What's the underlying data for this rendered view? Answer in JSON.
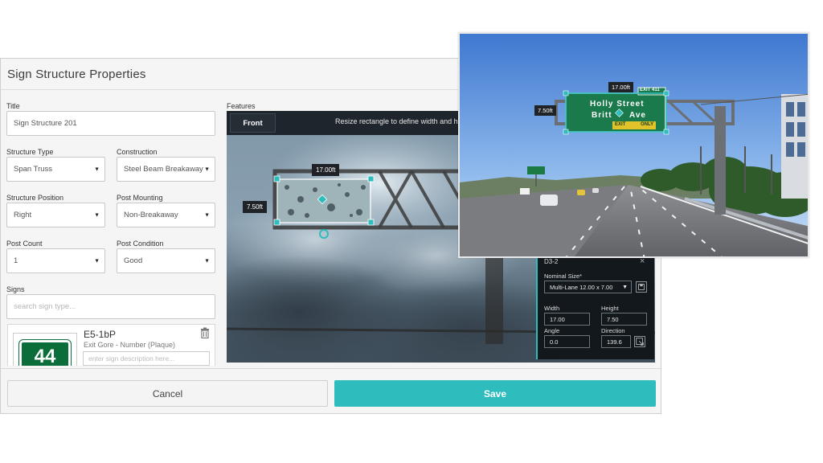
{
  "dialog": {
    "title": "Sign Structure Properties",
    "fields": {
      "title_label": "Title",
      "title_value": "Sign Structure 201",
      "structure_type_label": "Structure Type",
      "structure_type_value": "Span Truss",
      "construction_label": "Construction",
      "construction_value": "Steel Beam Breakaway",
      "structure_position_label": "Structure Position",
      "structure_position_value": "Right",
      "post_mounting_label": "Post Mounting",
      "post_mounting_value": "Non-Breakaway",
      "post_count_label": "Post Count",
      "post_count_value": "1",
      "post_condition_label": "Post Condition",
      "post_condition_value": "Good",
      "signs_label": "Signs",
      "signs_search_placeholder": "search sign type..."
    },
    "sign_item": {
      "code": "E5-1bP",
      "description": "Exit Gore - Number (Plaque)",
      "shield_number": "44",
      "description_placeholder": "enter sign description here..."
    },
    "buttons": {
      "cancel": "Cancel",
      "save": "Save"
    }
  },
  "features": {
    "label": "Features",
    "toolbar": {
      "view_button": "Front",
      "hint": "Resize rectangle to define width and height"
    },
    "width_tag": "17.00ft",
    "height_tag": "7.50ft",
    "panel": {
      "sign_id": "D3-2",
      "close_glyph": "×",
      "nominal_size_label": "Nominal Size*",
      "nominal_size_value": "Multi-Lane 12.00 x 7.00",
      "width_label": "Width",
      "width_value": "17.00",
      "height_label": "Height",
      "height_value": "7.50",
      "angle_label": "Angle",
      "angle_value": "0.0",
      "direction_label": "Direction",
      "direction_value": "139.6"
    }
  },
  "photo": {
    "width_tag": "17.00ft",
    "height_tag": "7.50ft",
    "sign_line1": "Holly Street",
    "sign_line2": "Britt",
    "sign_line2b": "Ave",
    "exit_tab": "EXIT 411",
    "exit_plaque": "EXIT",
    "exit_only": "ONLY"
  },
  "colors": {
    "accent": "#2ebcbd",
    "sign_green": "#1a7a4a",
    "dark_panel": "#13181d"
  }
}
